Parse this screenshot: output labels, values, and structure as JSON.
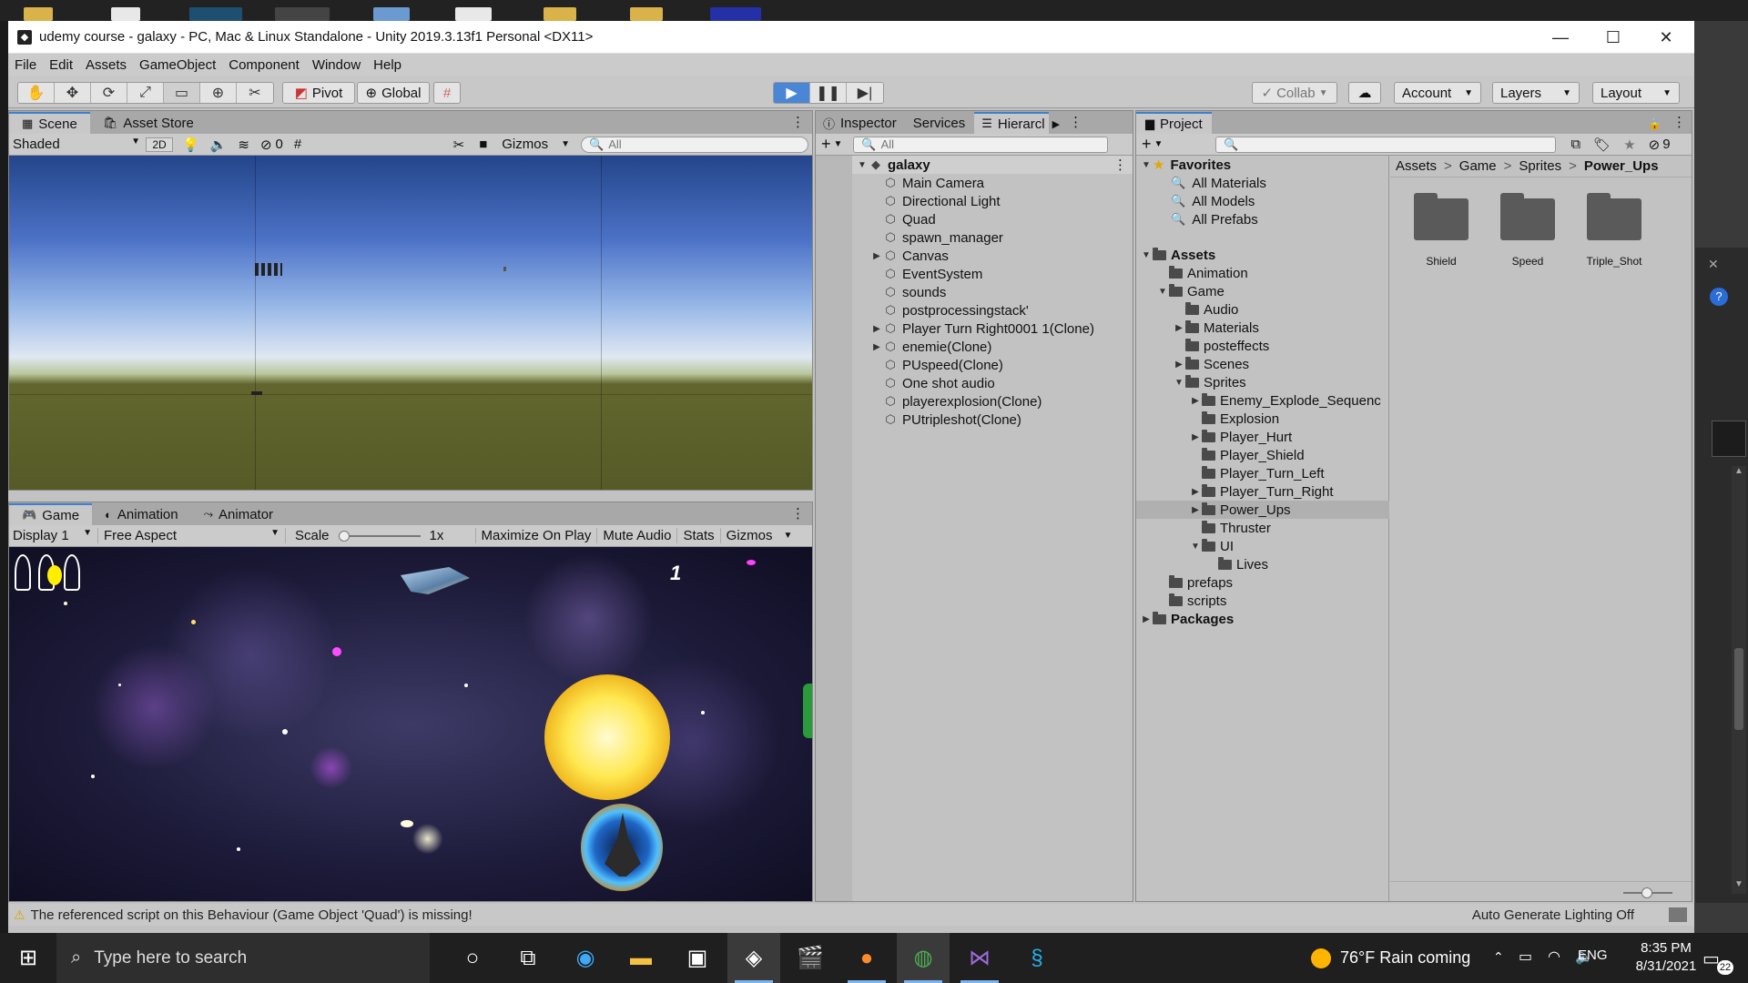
{
  "window": {
    "title": "udemy course - galaxy - PC, Mac & Linux Standalone - Unity 2019.3.13f1 Personal <DX11>",
    "controls": {
      "minimize": "—",
      "maximize": "☐",
      "close": "✕"
    }
  },
  "menu": [
    "File",
    "Edit",
    "Assets",
    "GameObject",
    "Component",
    "Window",
    "Help"
  ],
  "toolbar": {
    "tools": [
      "✋",
      "✥",
      "⟳",
      "⤢",
      "▭",
      "⊕",
      "✂"
    ],
    "pivot": "Pivot",
    "global": "Global",
    "collab": "Collab",
    "account": "Account",
    "layers": "Layers",
    "layout": "Layout"
  },
  "scene_panel": {
    "tabs": [
      "Scene",
      "Asset Store"
    ],
    "shading": "Shaded",
    "mode_2d": "2D",
    "hidden_count": "0",
    "gizmos": "Gizmos",
    "search_placeholder": "All"
  },
  "game_panel": {
    "tabs": [
      "Game",
      "Animation",
      "Animator"
    ],
    "display": "Display 1",
    "aspect": "Free Aspect",
    "scale_label": "Scale",
    "scale_value": "1x",
    "maximize": "Maximize On Play",
    "mute": "Mute Audio",
    "stats": "Stats",
    "gizmos": "Gizmos",
    "score": "1"
  },
  "inspector_panel": {
    "tabs": [
      "Inspector",
      "Services",
      "Hierarcl"
    ],
    "search_placeholder": "All",
    "scene_name": "galaxy",
    "items": [
      {
        "label": "Main Camera",
        "expandable": false
      },
      {
        "label": "Directional Light",
        "expandable": false
      },
      {
        "label": "Quad",
        "expandable": false
      },
      {
        "label": "spawn_manager",
        "expandable": false
      },
      {
        "label": "Canvas",
        "expandable": true
      },
      {
        "label": "EventSystem",
        "expandable": false
      },
      {
        "label": "sounds",
        "expandable": false
      },
      {
        "label": "postprocessingstack'",
        "expandable": false
      },
      {
        "label": "Player Turn Right0001 1(Clone)",
        "expandable": true
      },
      {
        "label": "enemie(Clone)",
        "expandable": true
      },
      {
        "label": "PUspeed(Clone)",
        "expandable": false
      },
      {
        "label": "One shot audio",
        "expandable": false
      },
      {
        "label": "playerexplosion(Clone)",
        "expandable": false
      },
      {
        "label": "PUtripleshot(Clone)",
        "expandable": false
      }
    ]
  },
  "project_panel": {
    "tab": "Project",
    "hidden_count": "9",
    "favorites": {
      "label": "Favorites",
      "items": [
        "All Materials",
        "All Models",
        "All Prefabs"
      ]
    },
    "tree": [
      {
        "label": "Assets",
        "depth": 0,
        "arrow": "open",
        "bold": true
      },
      {
        "label": "Animation",
        "depth": 1,
        "arrow": "none"
      },
      {
        "label": "Game",
        "depth": 1,
        "arrow": "open"
      },
      {
        "label": "Audio",
        "depth": 2,
        "arrow": "none"
      },
      {
        "label": "Materials",
        "depth": 2,
        "arrow": "closed"
      },
      {
        "label": "posteffects",
        "depth": 2,
        "arrow": "none"
      },
      {
        "label": "Scenes",
        "depth": 2,
        "arrow": "closed"
      },
      {
        "label": "Sprites",
        "depth": 2,
        "arrow": "open"
      },
      {
        "label": "Enemy_Explode_Sequenc",
        "depth": 3,
        "arrow": "closed"
      },
      {
        "label": "Explosion",
        "depth": 3,
        "arrow": "none"
      },
      {
        "label": "Player_Hurt",
        "depth": 3,
        "arrow": "closed"
      },
      {
        "label": "Player_Shield",
        "depth": 3,
        "arrow": "none"
      },
      {
        "label": "Player_Turn_Left",
        "depth": 3,
        "arrow": "none"
      },
      {
        "label": "Player_Turn_Right",
        "depth": 3,
        "arrow": "closed"
      },
      {
        "label": "Power_Ups",
        "depth": 3,
        "arrow": "closed",
        "selected": true
      },
      {
        "label": "Thruster",
        "depth": 3,
        "arrow": "none"
      },
      {
        "label": "UI",
        "depth": 3,
        "arrow": "open"
      },
      {
        "label": "Lives",
        "depth": 4,
        "arrow": "none"
      },
      {
        "label": "prefaps",
        "depth": 1,
        "arrow": "none"
      },
      {
        "label": "scripts",
        "depth": 1,
        "arrow": "none"
      },
      {
        "label": "Packages",
        "depth": 0,
        "arrow": "closed",
        "bold": true
      }
    ],
    "breadcrumb": [
      "Assets",
      "Game",
      "Sprites",
      "Power_Ups"
    ],
    "breadcrumb_sep": ">",
    "folders": [
      "Shield",
      "Speed",
      "Triple_Shot"
    ]
  },
  "status": {
    "warning": "The referenced script on this Behaviour (Game Object 'Quad') is missing!",
    "lighting": "Auto Generate Lighting Off"
  },
  "taskbar": {
    "search_placeholder": "Type here to search",
    "weather": "76°F  Rain coming",
    "language": "ENG",
    "time": "8:35 PM",
    "date": "8/31/2021",
    "notifications": "22"
  },
  "colors": {
    "accent": "#3c80d0",
    "play_active": "#4a86d6",
    "panel_bg": "#c2c2c2",
    "selection": "#b0b0b0"
  }
}
